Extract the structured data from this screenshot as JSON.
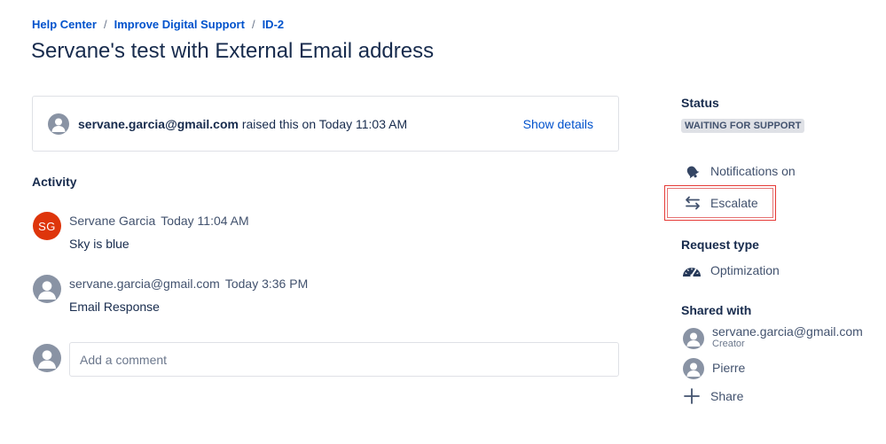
{
  "breadcrumb": {
    "items": [
      "Help Center",
      "Improve Digital Support",
      "ID-2"
    ],
    "separator": "/"
  },
  "title": "Servane's test with External Email address",
  "raised": {
    "user": "servane.garcia@gmail.com",
    "text": "raised this on Today 11:03 AM",
    "show_details": "Show details"
  },
  "activity": {
    "heading": "Activity",
    "items": [
      {
        "initials": "SG",
        "author": "Servane Garcia",
        "time": "Today 11:04 AM",
        "body": "Sky is blue"
      },
      {
        "initials": "",
        "author": "servane.garcia@gmail.com",
        "time": "Today 3:36 PM",
        "body": "Email Response"
      }
    ],
    "comment_placeholder": "Add a comment"
  },
  "sidebar": {
    "status_label": "Status",
    "status_value": "WAITING FOR SUPPORT",
    "notifications": "Notifications on",
    "escalate": "Escalate",
    "request_type_label": "Request type",
    "request_type_value": "Optimization",
    "shared_label": "Shared with",
    "shared": [
      {
        "name": "servane.garcia@gmail.com",
        "role": "Creator"
      },
      {
        "name": "Pierre",
        "role": ""
      }
    ],
    "share": "Share"
  },
  "colors": {
    "link": "#0052cc",
    "text": "#172b4d",
    "avatar_red": "#de350b",
    "avatar_grey": "#8993a4",
    "highlight": "#e53935"
  },
  "icons": [
    "person-avatar-icon",
    "bell-icon",
    "swap-arrows-icon",
    "gauge-icon",
    "plus-icon"
  ]
}
